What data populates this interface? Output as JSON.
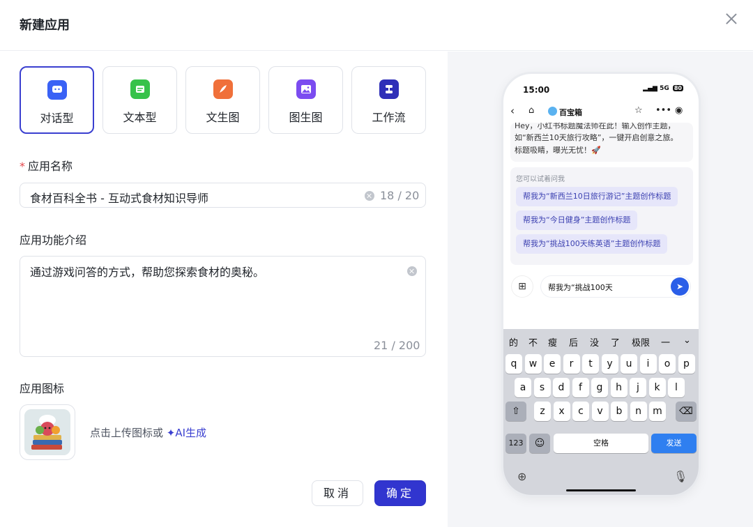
{
  "dialog": {
    "title": "新建应用"
  },
  "types": [
    {
      "label": "对话型",
      "icon": "chat-bubble-icon",
      "color": "#3a62f5"
    },
    {
      "label": "文本型",
      "icon": "text-doc-icon",
      "color": "#37c24a"
    },
    {
      "label": "文生图",
      "icon": "brush-icon",
      "color": "#f0703a"
    },
    {
      "label": "图生图",
      "icon": "image-icon",
      "color": "#7b4cf0"
    },
    {
      "label": "工作流",
      "icon": "workflow-icon",
      "color": "#2f2fb8"
    }
  ],
  "fields": {
    "name_label": "应用名称",
    "name_required": "*",
    "name_value": "食材百科全书 - 互动式食材知识导师",
    "name_count": "18 / 20",
    "desc_label": "应用功能介绍",
    "desc_value": "通过游戏问答的方式，帮助您探索食材的奥秘。",
    "desc_count": "21 / 200",
    "icon_label": "应用图标",
    "upload_hint": "点击上传图标或",
    "ai_link": "✦AI生成"
  },
  "buttons": {
    "cancel": "取消",
    "ok": "确定"
  },
  "preview": {
    "time": "15:00",
    "signal": "5G",
    "battery": "80",
    "app_name": "百宝箱",
    "chat_lines": [
      "Hey，小红书标题魔法师在此！输入创作主题，",
      "如“新西兰10天旅行攻略”，一键开启创意之旅。",
      "标题吸睛，曝光无忧！🚀"
    ],
    "suggest_title": "您可以试着问我",
    "suggestions": [
      "帮我为“新西兰10日旅行游记”主题创作标题",
      "帮我为“今日健身”主题创作标题",
      "帮我为“挑战100天练英语”主题创作标题"
    ],
    "input_text": "帮我为“挑战100天",
    "candidates": [
      "的",
      "不",
      "瘦",
      "后",
      "没",
      "了",
      "极限",
      "一"
    ],
    "row1": [
      "q",
      "w",
      "e",
      "r",
      "t",
      "y",
      "u",
      "i",
      "o",
      "p"
    ],
    "row2": [
      "a",
      "s",
      "d",
      "f",
      "g",
      "h",
      "j",
      "k",
      "l"
    ],
    "row3": [
      "z",
      "x",
      "c",
      "v",
      "b",
      "n",
      "m"
    ],
    "key_123": "123",
    "space": "空格",
    "send": "发送"
  }
}
